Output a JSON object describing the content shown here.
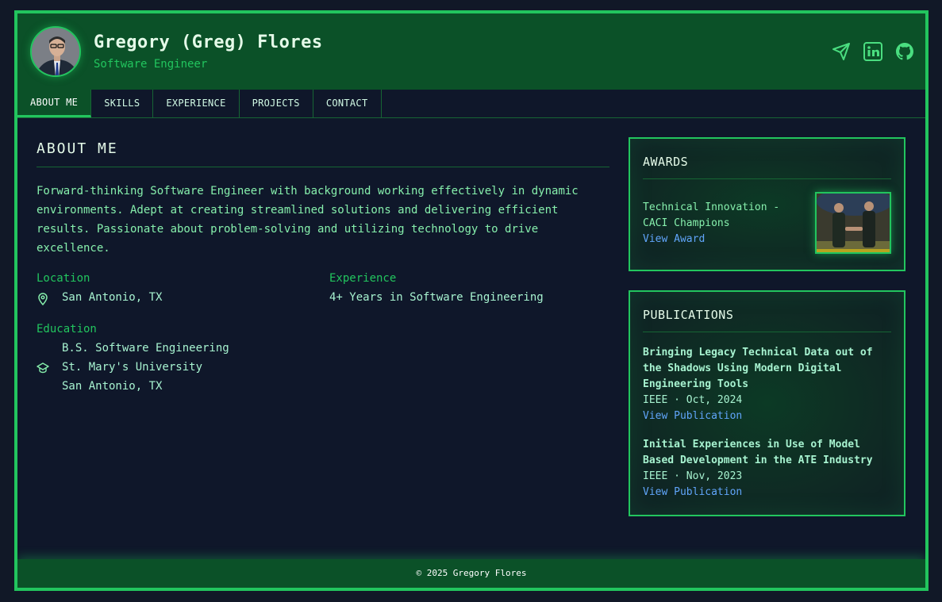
{
  "header": {
    "name": "Gregory (Greg) Flores",
    "role": "Software Engineer",
    "social": [
      "send-icon",
      "linkedin-icon",
      "github-icon"
    ]
  },
  "nav": {
    "tabs": [
      {
        "label": "ABOUT ME",
        "active": true
      },
      {
        "label": "SKILLS"
      },
      {
        "label": "EXPERIENCE"
      },
      {
        "label": "PROJECTS"
      },
      {
        "label": "CONTACT"
      }
    ]
  },
  "about": {
    "heading": "ABOUT ME",
    "intro": "Forward-thinking Software Engineer with background working effectively in dynamic environments. Adept at creating streamlined solutions and delivering efficient results. Passionate about problem-solving and utilizing technology to drive excellence.",
    "location_label": "Location",
    "location_value": "San Antonio, TX",
    "experience_label": "Experience",
    "experience_value": "4+ Years in Software Engineering",
    "education_label": "Education",
    "education_degree": "B.S. Software Engineering",
    "education_school": "St. Mary's University",
    "education_city": "San Antonio, TX"
  },
  "awards": {
    "heading": "AWARDS",
    "title": "Technical Innovation - CACI Champions",
    "link": "View Award"
  },
  "publications": {
    "heading": "PUBLICATIONS",
    "items": [
      {
        "title": "Bringing Legacy Technical Data out of the Shadows Using Modern Digital Engineering Tools",
        "meta": "IEEE · Oct, 2024",
        "link": "View Publication"
      },
      {
        "title": "Initial Experiences in Use of Model Based Development in the ATE Industry",
        "meta": "IEEE · Nov, 2023",
        "link": "View Publication"
      }
    ]
  },
  "footer": {
    "text": "© 2025 Gregory Flores"
  },
  "colors": {
    "accent": "#22c55e",
    "header_bg": "#0b5128",
    "page_bg": "#0f172a",
    "link": "#60a5fa"
  }
}
